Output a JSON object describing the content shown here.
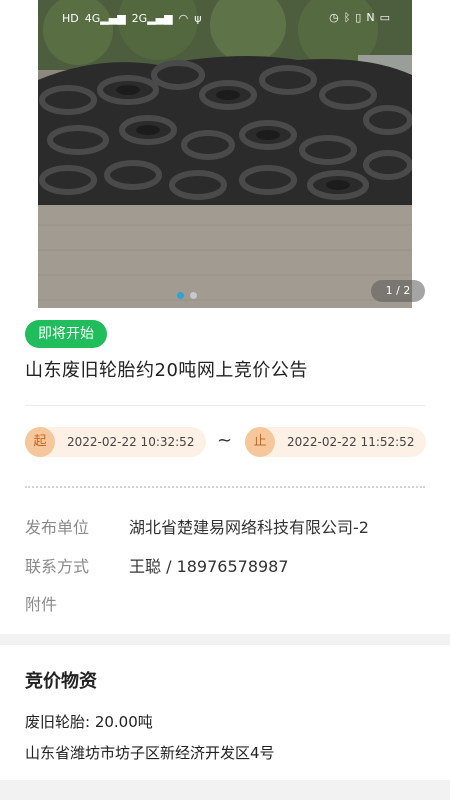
{
  "status_bar": {
    "left_icons": [
      "HD",
      "4G",
      "2G",
      "wifi-icon",
      "usb-icon"
    ],
    "right_icons": [
      "alarm-icon",
      "bluetooth-icon",
      "vibrate-icon",
      "nfc-icon",
      "battery-icon"
    ]
  },
  "gallery": {
    "counter": "1 / 2",
    "current_index": 1,
    "total": 2
  },
  "announcement": {
    "status": "即将开始",
    "title": "山东废旧轮胎约20吨网上竞价公告",
    "start_marker": "起",
    "start_time": "2022-02-22 10:32:52",
    "separator": "~",
    "end_marker": "止",
    "end_time": "2022-02-22 11:52:52"
  },
  "details": {
    "publisher_label": "发布单位",
    "publisher_value": "湖北省楚建易网络科技有限公司-2",
    "contact_label": "联系方式",
    "contact_value": "王聪 / 18976578987",
    "attachment_label": "附件"
  },
  "materials": {
    "section_title": "竞价物资",
    "item": "废旧轮胎: 20.00吨",
    "location": "山东省潍坊市坊子区新经济开发区4号"
  },
  "colors": {
    "status_green": "#1fbd5c",
    "time_pill_bg": "#fdf1e6",
    "time_marker": "#f6c79c",
    "dot_active": "#2fa3d6"
  }
}
